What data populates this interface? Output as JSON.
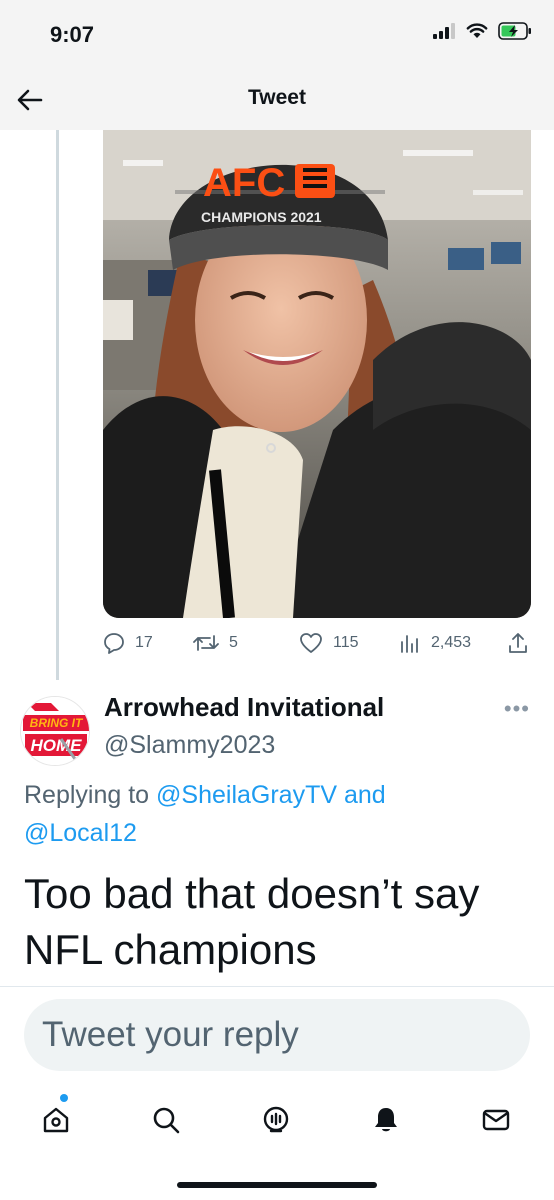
{
  "status_bar": {
    "time": "9:07"
  },
  "nav": {
    "title": "Tweet"
  },
  "tweet_actions": {
    "replies": "17",
    "retweets": "5",
    "likes": "115",
    "views": "2,453"
  },
  "media": {
    "hat_text_line1": "AFC",
    "hat_text_line2": "CHAMPIONS 2021",
    "avatar_badge_line1": "BRING IT",
    "avatar_badge_line2": "HOME"
  },
  "reply": {
    "display_name": "Arrowhead Invitational",
    "handle": "@Slammy2023",
    "replying_prefix": "Replying to",
    "mention_1": "@SheilaGrayTV",
    "conjunction": "and",
    "mention_2": "@Local12",
    "text": "Too bad that doesn’t say NFL champions"
  },
  "composer": {
    "placeholder": "Tweet your reply"
  },
  "tabs": [
    "home-icon",
    "search-icon",
    "spaces-icon",
    "notifications-icon",
    "messages-icon"
  ],
  "colors": {
    "accent": "#1d9bf0",
    "secondary_text": "#536471",
    "bengals_orange": "#fb4f14"
  }
}
